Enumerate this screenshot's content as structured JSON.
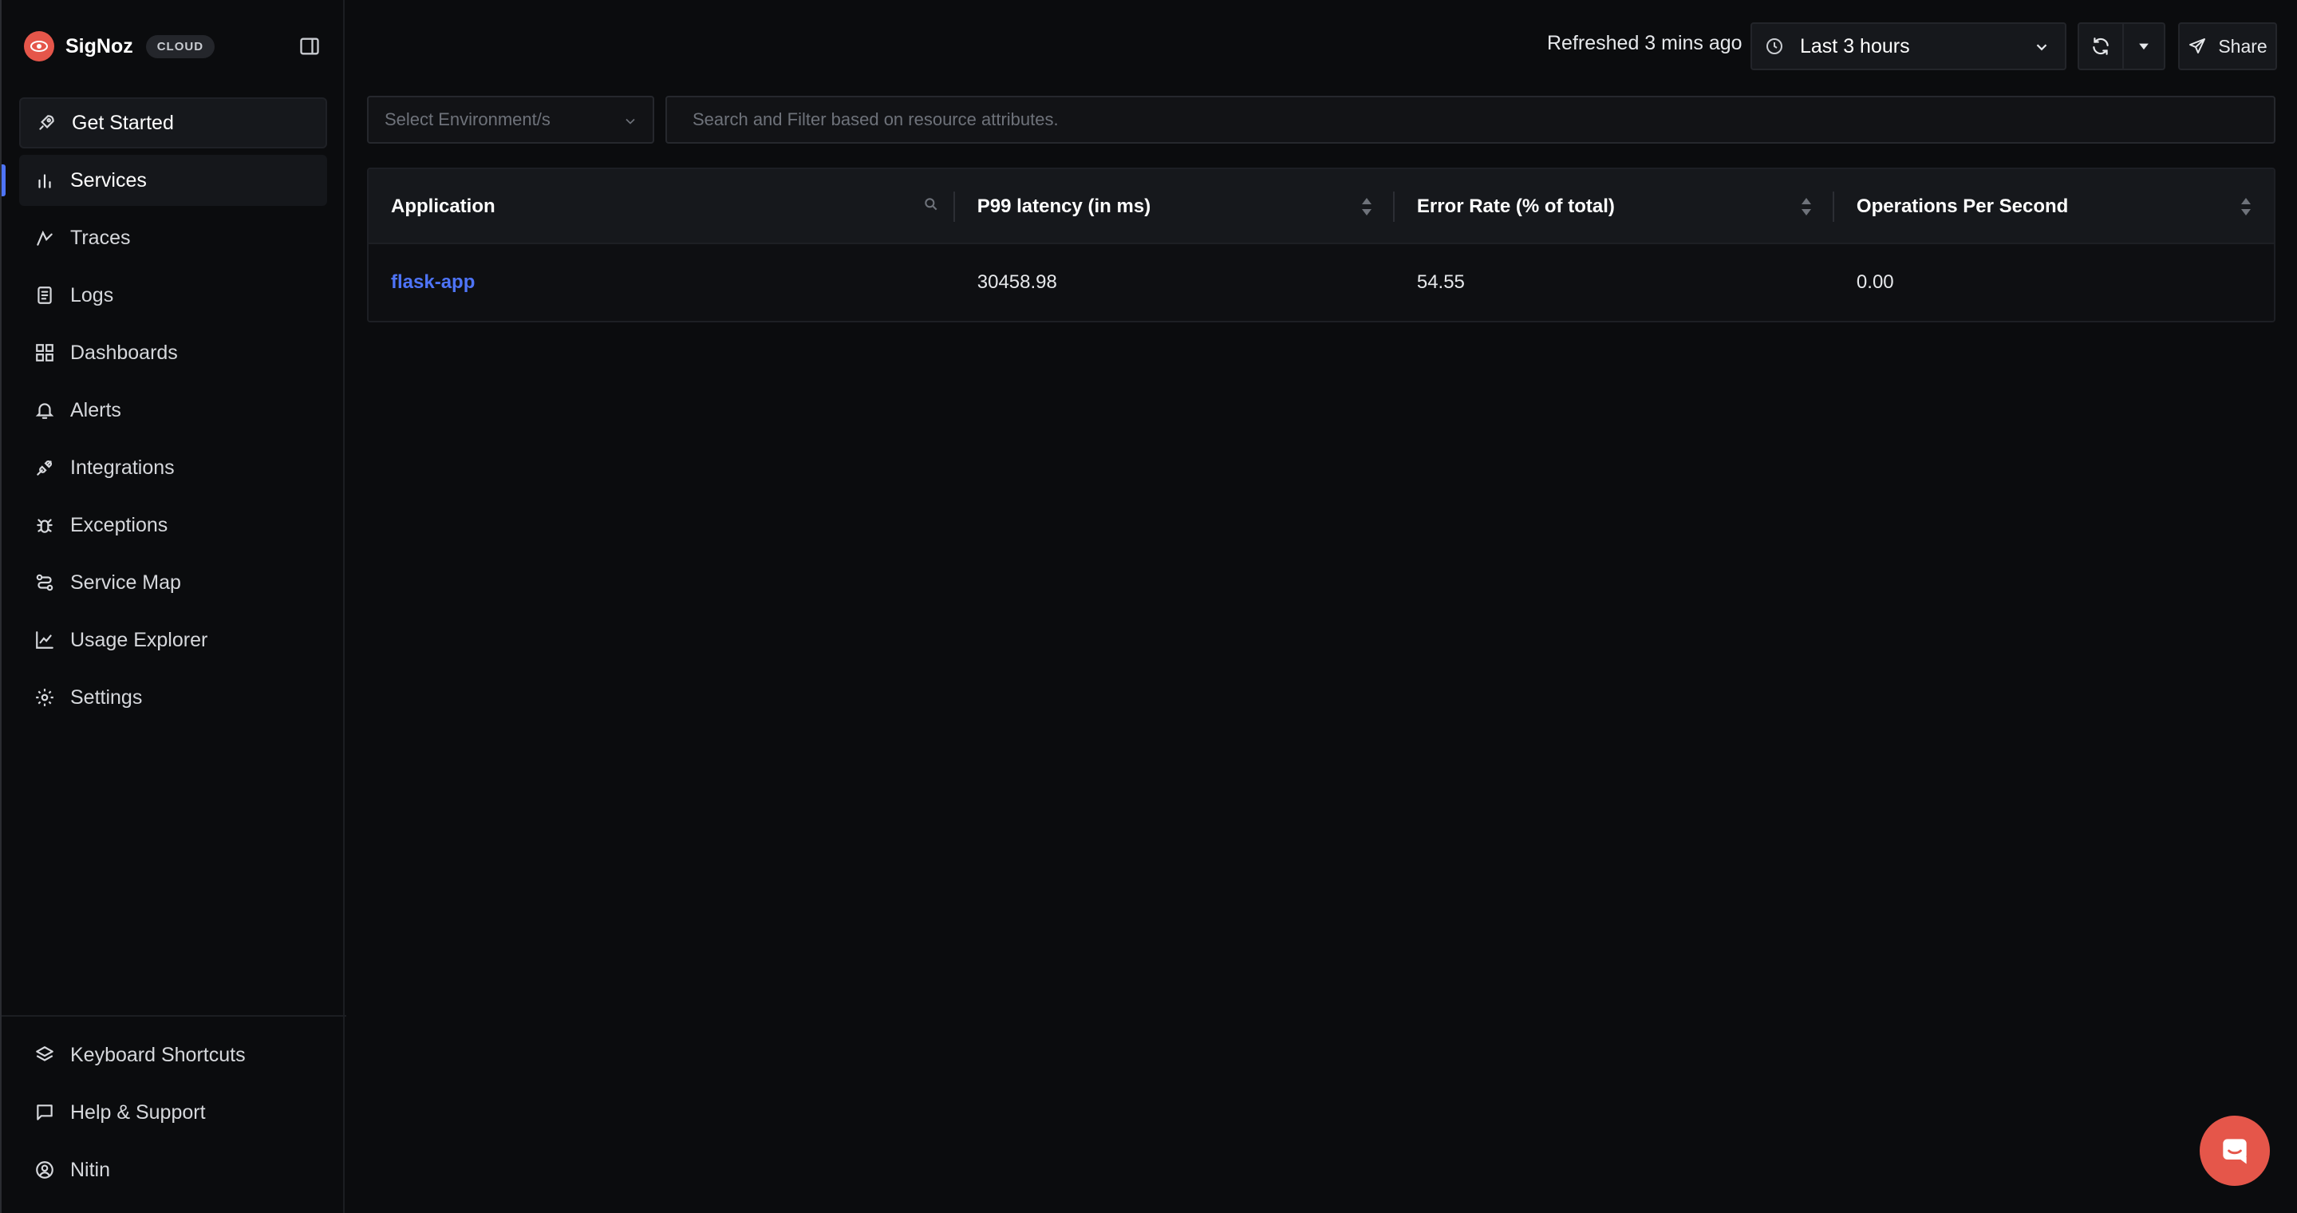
{
  "brand": {
    "name": "SigNoz",
    "badge": "CLOUD"
  },
  "sidebar": {
    "get_started": "Get Started",
    "items": [
      {
        "label": "Services",
        "icon": "bar-chart-icon"
      },
      {
        "label": "Traces",
        "icon": "route-icon"
      },
      {
        "label": "Logs",
        "icon": "scroll-icon"
      },
      {
        "label": "Dashboards",
        "icon": "grid-icon"
      },
      {
        "label": "Alerts",
        "icon": "bell-icon"
      },
      {
        "label": "Integrations",
        "icon": "plug-icon"
      },
      {
        "label": "Exceptions",
        "icon": "bug-icon"
      },
      {
        "label": "Service Map",
        "icon": "route-map-icon"
      },
      {
        "label": "Usage Explorer",
        "icon": "line-chart-icon"
      },
      {
        "label": "Settings",
        "icon": "gear-icon"
      }
    ],
    "footer": [
      {
        "label": "Keyboard Shortcuts",
        "icon": "layers-icon"
      },
      {
        "label": "Help & Support",
        "icon": "message-icon"
      },
      {
        "label": "Nitin",
        "icon": "user-circle-icon"
      }
    ],
    "active_item": "Services"
  },
  "topbar": {
    "refreshed": "Refreshed 3 mins ago",
    "time_range": "Last 3 hours",
    "share": "Share"
  },
  "filters": {
    "environment_placeholder": "Select Environment/s",
    "search_placeholder": "Search and Filter based on resource attributes."
  },
  "table": {
    "columns": [
      "Application",
      "P99 latency (in ms)",
      "Error Rate (% of total)",
      "Operations Per Second"
    ],
    "rows": [
      {
        "application": "flask-app",
        "p99": "30458.98",
        "error_rate": "54.55",
        "ops": "0.00"
      }
    ]
  },
  "colors": {
    "accent": "#4e74f8",
    "brand": "#e5564a",
    "background": "#0b0c0e"
  }
}
